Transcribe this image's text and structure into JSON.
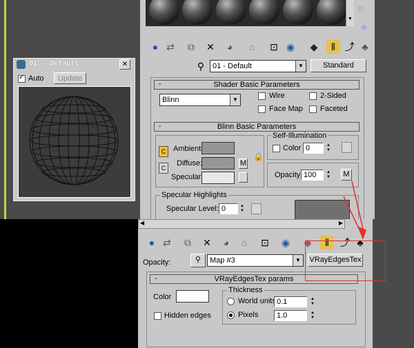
{
  "viewport_window": {
    "title": "01 - Default",
    "close": "✕",
    "auto_label": "Auto",
    "update_label": "Update"
  },
  "material_editor": {
    "material_name": "01 - Default",
    "material_type": "Standard",
    "rollout_shader": "Shader Basic Parameters",
    "shader_type": "Blinn",
    "wire_label": "Wire",
    "two_sided_label": "2-Sided",
    "face_map_label": "Face Map",
    "faceted_label": "Faceted",
    "rollout_blinn": "Blinn Basic Parameters",
    "self_illum_title": "Self-Illumination",
    "color_label": "Color",
    "self_illum_value": "0",
    "ambient_label": "Ambient:",
    "diffuse_label": "Diffuse:",
    "specular_label": "Specular:",
    "m_label": "M",
    "opacity_label": "Opacity:",
    "opacity_value": "100",
    "lock_c": "C",
    "spec_highlights_title": "Specular Highlights",
    "spec_level_label": "Specular Level:",
    "spec_level_value": "0"
  },
  "map_editor": {
    "opacity_label": "Opacity:",
    "map_name": "Map #3",
    "map_type": "VRayEdgesTex",
    "rollout_title": "VRayEdgesTex params",
    "color_label": "Color",
    "hidden_edges_label": "Hidden edges",
    "thickness_title": "Thickness",
    "world_units_label": "World units",
    "world_units_value": "0.1",
    "pixels_label": "Pixels",
    "pixels_value": "1.0"
  },
  "colors": {
    "highlight_red": "#e03030",
    "panel_gray": "#c8c8c8",
    "viewport_dark": "#4a4a4a"
  }
}
